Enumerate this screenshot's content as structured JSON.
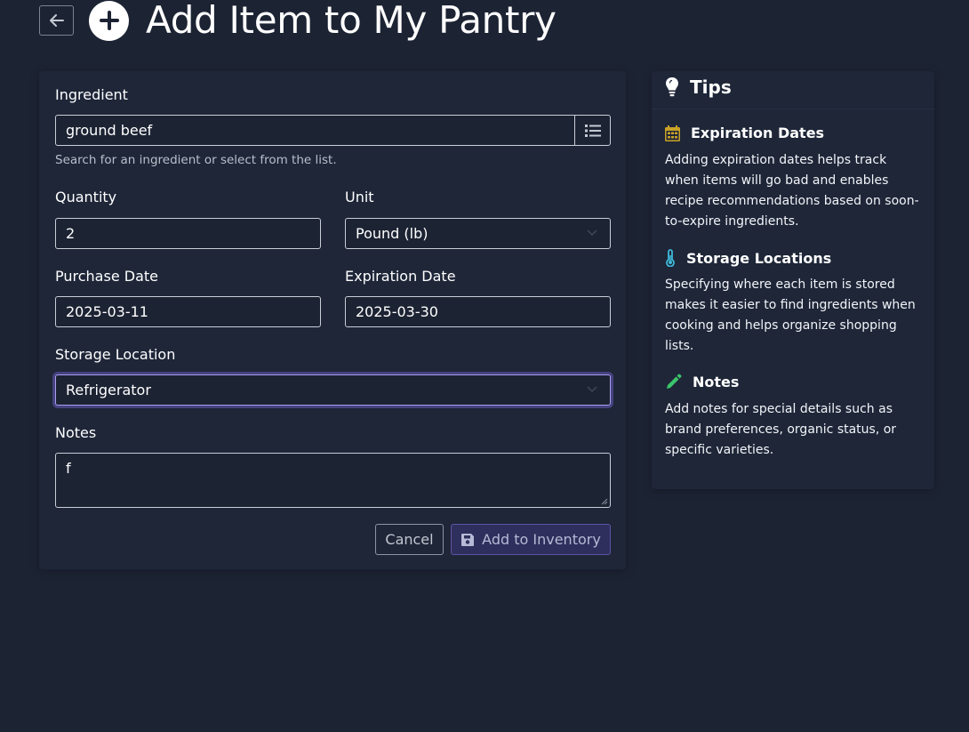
{
  "header": {
    "title": "Add Item to My Pantry"
  },
  "form": {
    "ingredient": {
      "label": "Ingredient",
      "value": "ground beef",
      "help": "Search for an ingredient or select from the list."
    },
    "quantity": {
      "label": "Quantity",
      "value": "2"
    },
    "unit": {
      "label": "Unit",
      "value": "Pound (lb)"
    },
    "purchase_date": {
      "label": "Purchase Date",
      "value": "2025-03-11"
    },
    "expiration_date": {
      "label": "Expiration Date",
      "value": "2025-03-30"
    },
    "storage_location": {
      "label": "Storage Location",
      "value": "Refrigerator"
    },
    "notes": {
      "label": "Notes",
      "value": "f"
    },
    "cancel_label": "Cancel",
    "submit_label": "Add to Inventory"
  },
  "tips": {
    "title": "Tips",
    "items": [
      {
        "icon": "calendar-icon",
        "icon_color": "#c9a227",
        "title": "Expiration Dates",
        "body": "Adding expiration dates helps track when items will go bad and enables recipe recommendations based on soon-to-expire ingredients."
      },
      {
        "icon": "thermometer-icon",
        "icon_color": "#3fb8d8",
        "title": "Storage Locations",
        "body": "Specifying where each item is stored makes it easier to find ingredients when cooking and helps organize shopping lists."
      },
      {
        "icon": "pencil-icon",
        "icon_color": "#3cc46a",
        "title": "Notes",
        "body": "Add notes for special details such as brand preferences, organic status, or specific varieties."
      }
    ]
  },
  "colors": {
    "background": "#1c2333",
    "card": "#1e2638",
    "accent": "#a99df0",
    "submit_bg": "#2e2f5c"
  }
}
